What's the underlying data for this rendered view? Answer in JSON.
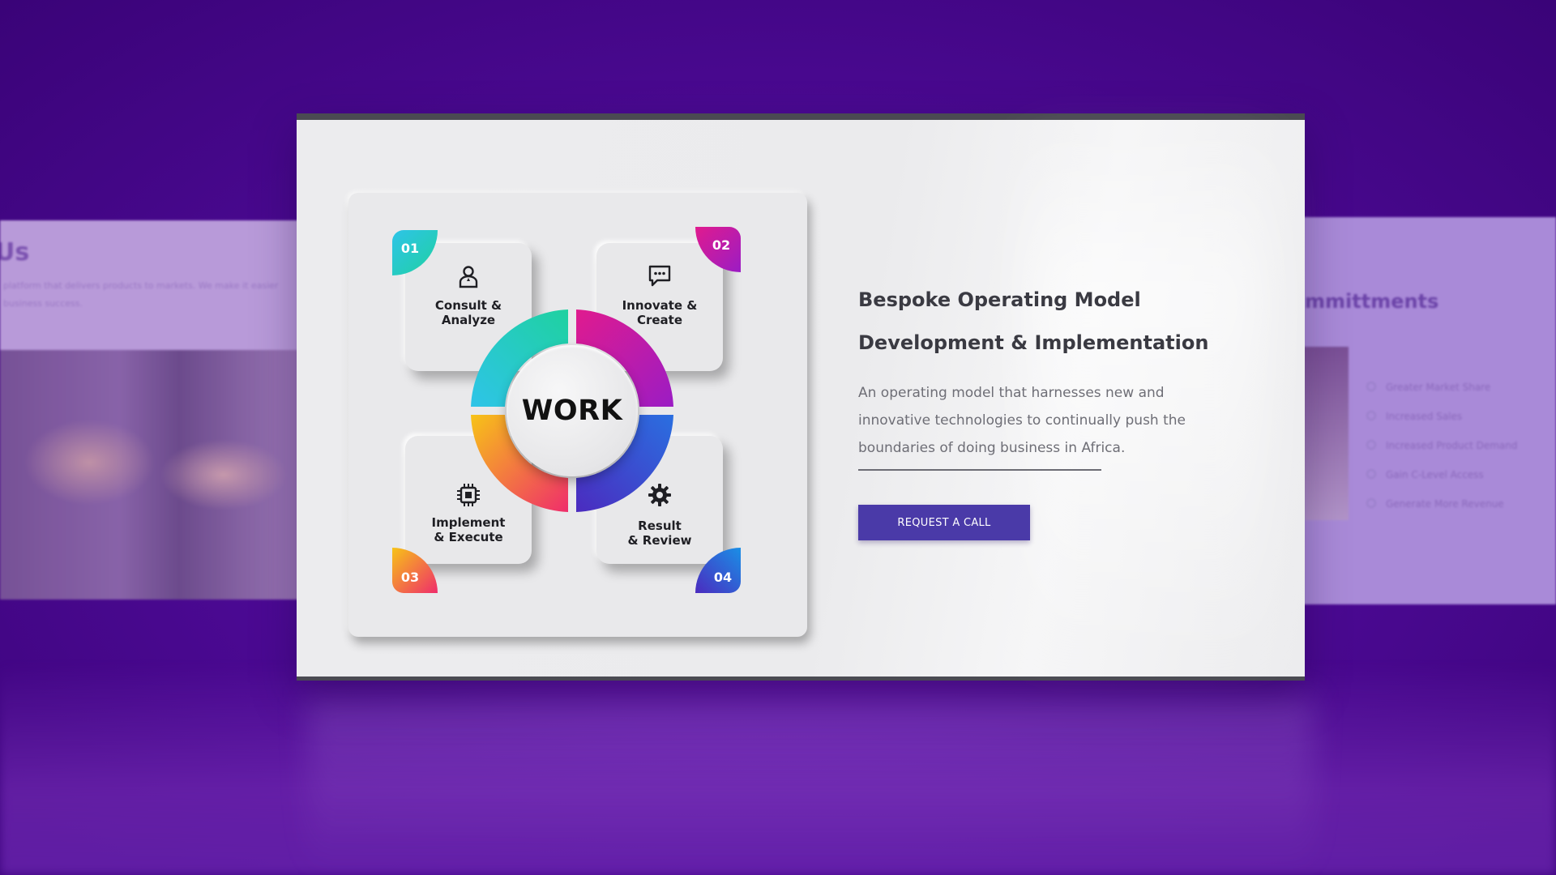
{
  "left_slide": {
    "title": "Us",
    "blurb": "platform that delivers products to markets. We make it easier business success."
  },
  "right_slide": {
    "title": "mmittments",
    "items": [
      {
        "label": "Greater Market Share"
      },
      {
        "label": "Increased Sales"
      },
      {
        "label": "Increased Product Demand"
      },
      {
        "label": "Gain C-Level Access"
      },
      {
        "label": "Generate More Revenue"
      }
    ]
  },
  "diagram": {
    "center_label": "WORK",
    "steps": [
      {
        "number": "01",
        "label_line1": "Consult &",
        "label_line2": "Analyze",
        "icon": "person-icon",
        "color_a": "#2ec4e8",
        "color_b": "#1fd1a0"
      },
      {
        "number": "02",
        "label_line1": "Innovate &",
        "label_line2": "Create",
        "icon": "chat-icon",
        "color_a": "#e01b8e",
        "color_b": "#9b1cc4"
      },
      {
        "number": "03",
        "label_line1": "Implement",
        "label_line2": "& Execute",
        "icon": "chip-icon",
        "color_a": "#f7c317",
        "color_b": "#ef2d6b"
      },
      {
        "number": "04",
        "label_line1": "Result",
        "label_line2": "& Review",
        "icon": "gear-icon",
        "color_a": "#1a8fe6",
        "color_b": "#4b2bbf"
      }
    ]
  },
  "content": {
    "headline_line1": "Bespoke Operating Model",
    "headline_line2": "Development & Implementation",
    "description": "An operating model that harnesses new and innovative technologies to continually push the boundaries of doing business in Africa.",
    "cta_label": "REQUEST A CALL"
  },
  "colors": {
    "background": "#4d0a96",
    "cta": "#4a3aa8",
    "headline": "#3a3a42"
  }
}
